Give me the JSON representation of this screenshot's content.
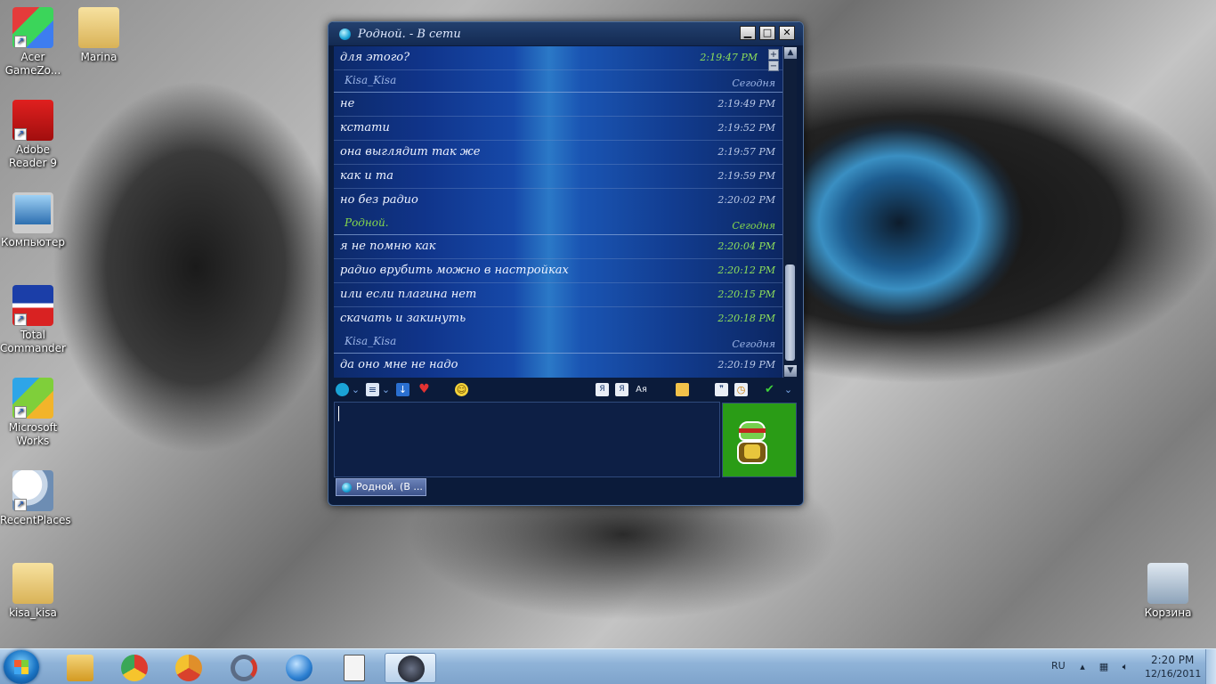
{
  "desktop": {
    "icons_left": [
      {
        "label": "Acer GameZo...",
        "icon": "acer-gamezone-icon"
      },
      {
        "label": "Marina",
        "icon": "folder-icon"
      },
      {
        "label": "Adobe Reader 9",
        "icon": "adobe-reader-icon"
      },
      {
        "label": "Компьютер",
        "icon": "computer-icon"
      },
      {
        "label": "Total Commander",
        "icon": "total-commander-icon"
      },
      {
        "label": "Microsoft Works",
        "icon": "microsoft-works-icon"
      },
      {
        "label": "RecentPlaces",
        "icon": "recent-places-icon"
      },
      {
        "label": "kisa_kisa",
        "icon": "folder-icon"
      }
    ],
    "recycle_bin": {
      "label": "Корзина",
      "icon": "recycle-bin-icon"
    }
  },
  "chat_window": {
    "title": "Родной. - В сети",
    "history": [
      {
        "type": "message",
        "text": "для этого?",
        "time": "2:19:47 PM",
        "mine": true
      },
      {
        "type": "sender",
        "name": "Kisa_Kisa",
        "date": "Сегодня",
        "mine": false
      },
      {
        "type": "message",
        "text": "не",
        "time": "2:19:49 PM",
        "mine": false
      },
      {
        "type": "message",
        "text": "кстати",
        "time": "2:19:52 PM",
        "mine": false
      },
      {
        "type": "message",
        "text": "она выглядит так же",
        "time": "2:19:57 PM",
        "mine": false
      },
      {
        "type": "message",
        "text": "как и та",
        "time": "2:19:59 PM",
        "mine": false
      },
      {
        "type": "message",
        "text": "но без радио",
        "time": "2:20:02 PM",
        "mine": false
      },
      {
        "type": "sender",
        "name": "Родной.",
        "date": "Сегодня",
        "mine": true
      },
      {
        "type": "message",
        "text": "я не помню как",
        "time": "2:20:04 PM",
        "mine": true
      },
      {
        "type": "message",
        "text": "радио врубить можно в настройках",
        "time": "2:20:12 PM",
        "mine": true
      },
      {
        "type": "message",
        "text": "или если плагина нет",
        "time": "2:20:15 PM",
        "mine": true
      },
      {
        "type": "message",
        "text": "скачать и закинуть",
        "time": "2:20:18 PM",
        "mine": true
      },
      {
        "type": "sender",
        "name": "Kisa_Kisa",
        "date": "Сегодня",
        "mine": false
      },
      {
        "type": "message",
        "text": "да оно мне не надо",
        "time": "2:20:19 PM",
        "mine": false
      }
    ],
    "tab_label": "Родной. (В ..."
  },
  "taskbar": {
    "pinned": [
      {
        "name": "explorer-icon",
        "color": "#e8b93a"
      },
      {
        "name": "chrome-icon",
        "color": "#de3b2e"
      },
      {
        "name": "chrome-icon-2",
        "color": "#e08f2a"
      },
      {
        "name": "media-icon",
        "color": "#5b6c85"
      },
      {
        "name": "thunderbird-icon",
        "color": "#2c7fd1"
      },
      {
        "name": "document-icon",
        "color": "#f4f4f4"
      },
      {
        "name": "qip-icon",
        "color": "#2b2f3a"
      }
    ],
    "language": "RU",
    "clock_time": "2:20 PM",
    "clock_date": "12/16/2011"
  }
}
